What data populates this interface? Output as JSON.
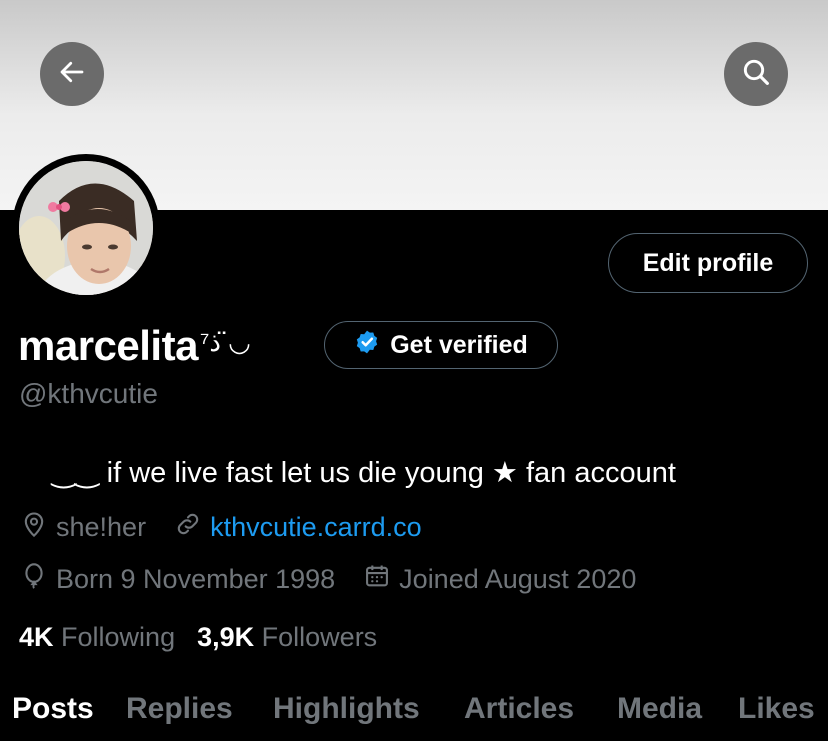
{
  "profile": {
    "display_name": "marcelita",
    "name_suffix": "ذ⁷ ◡̈",
    "handle": "@kthvcutie",
    "bio": "‿‿ if we live fast let us die young ★ fan account",
    "pronouns": "she!her",
    "link": "kthvcutie.carrd.co",
    "birthday": "Born 9 November 1998",
    "joined": "Joined August 2020"
  },
  "buttons": {
    "edit_profile": "Edit profile",
    "get_verified": "Get verified"
  },
  "stats": {
    "following_count": "4K",
    "following_label": "Following",
    "followers_count": "3,9K",
    "followers_label": "Followers"
  },
  "tabs": [
    "Posts",
    "Replies",
    "Highlights",
    "Articles",
    "Media",
    "Likes"
  ],
  "active_tab": "Posts",
  "colors": {
    "accent": "#1d9bf0",
    "muted": "#71767b",
    "background": "#000000"
  },
  "icons": [
    "back-arrow-icon",
    "search-icon",
    "verified-badge-icon",
    "location-icon",
    "link-icon",
    "birthday-balloon-icon",
    "calendar-icon"
  ]
}
